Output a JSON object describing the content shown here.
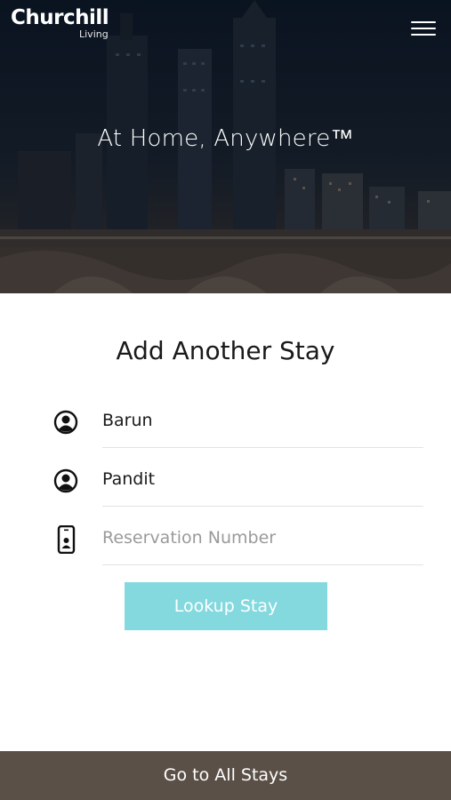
{
  "brand": {
    "name": "Churchill",
    "sub": "Living"
  },
  "hero": {
    "tagline": "At Home, Anywhere™"
  },
  "form": {
    "title": "Add Another Stay",
    "first_name": {
      "value": "Barun",
      "icon": "user-circle-icon"
    },
    "last_name": {
      "value": "Pandit",
      "icon": "user-circle-icon"
    },
    "reservation": {
      "value": "",
      "placeholder": "Reservation Number",
      "icon": "phone-badge-icon"
    },
    "lookup_label": "Lookup Stay"
  },
  "footer": {
    "label": "Go to All Stays"
  },
  "colors": {
    "accent": "#84d9de",
    "footer": "#5b5047",
    "text": "#1a1a1a"
  }
}
